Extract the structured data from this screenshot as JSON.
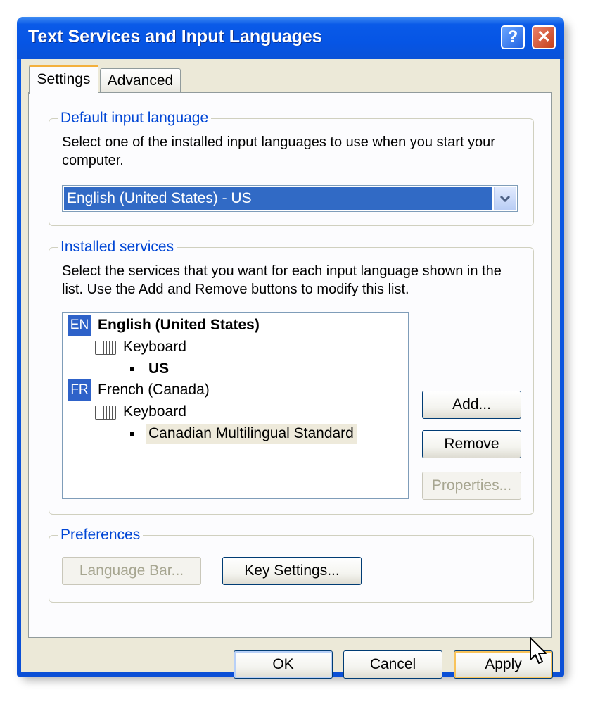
{
  "window": {
    "title": "Text Services and Input Languages",
    "help_glyph": "?",
    "close_glyph": "✕"
  },
  "tabs": [
    {
      "label": "Settings",
      "selected": true
    },
    {
      "label": "Advanced",
      "selected": false
    }
  ],
  "default_input_language": {
    "legend": "Default input language",
    "description_line1": "Select one of the installed input languages to use when you start your",
    "description_line2": "computer.",
    "selected_value": "English (United States) - US"
  },
  "installed_services": {
    "legend": "Installed services",
    "description_line1": "Select the services that you want for each input language shown in the",
    "description_line2": "list. Use the Add and Remove buttons to modify this list.",
    "languages": [
      {
        "badge": "EN",
        "name": "English (United States)",
        "category": "Keyboard",
        "layout": "US"
      },
      {
        "badge": "FR",
        "name": "French (Canada)",
        "category": "Keyboard",
        "layout": "Canadian Multilingual Standard"
      }
    ],
    "buttons": {
      "add": "Add...",
      "remove": "Remove",
      "properties": "Properties..."
    }
  },
  "preferences": {
    "legend": "Preferences",
    "language_bar": "Language Bar...",
    "key_settings": "Key Settings..."
  },
  "footer": {
    "ok": "OK",
    "cancel": "Cancel",
    "apply": "Apply"
  },
  "colors": {
    "title_bar": "#0a5ae8",
    "legend_text": "#0046d5",
    "selection": "#316ac5",
    "face": "#ece9d8"
  }
}
